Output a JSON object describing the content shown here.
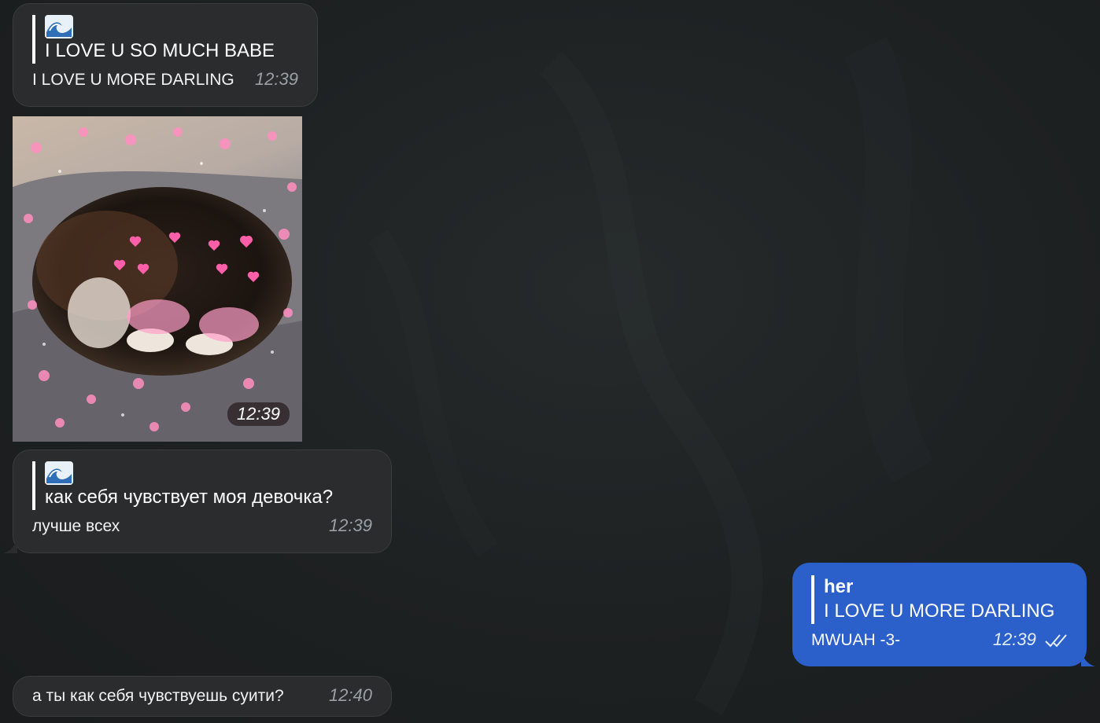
{
  "messages": {
    "m1": {
      "reply_sender_icon": "water-wave-emoji-icon",
      "reply_quote": "I LOVE U SO MUCH BABE",
      "text": "I LOVE U MORE DARLING",
      "time": "12:39"
    },
    "photo": {
      "icon": "cat-with-hearts-photo",
      "time": "12:39"
    },
    "m2": {
      "reply_sender_icon": "water-wave-emoji-icon",
      "reply_quote": "как себя чувствует моя девочка?",
      "text": "лучше всех",
      "time": "12:39"
    },
    "m3": {
      "reply_sender": "her",
      "reply_quote": "I LOVE U MORE DARLING",
      "text": "MWUAH -3-",
      "time": "12:39",
      "status_icon": "double-check-icon"
    },
    "m4": {
      "text": "а ты как себя чувствуешь суити?",
      "time": "12:40"
    }
  },
  "colors": {
    "background": "#1e2122",
    "incoming_bubble": "#2a2c2e",
    "outgoing_bubble": "#2b5fc9"
  }
}
